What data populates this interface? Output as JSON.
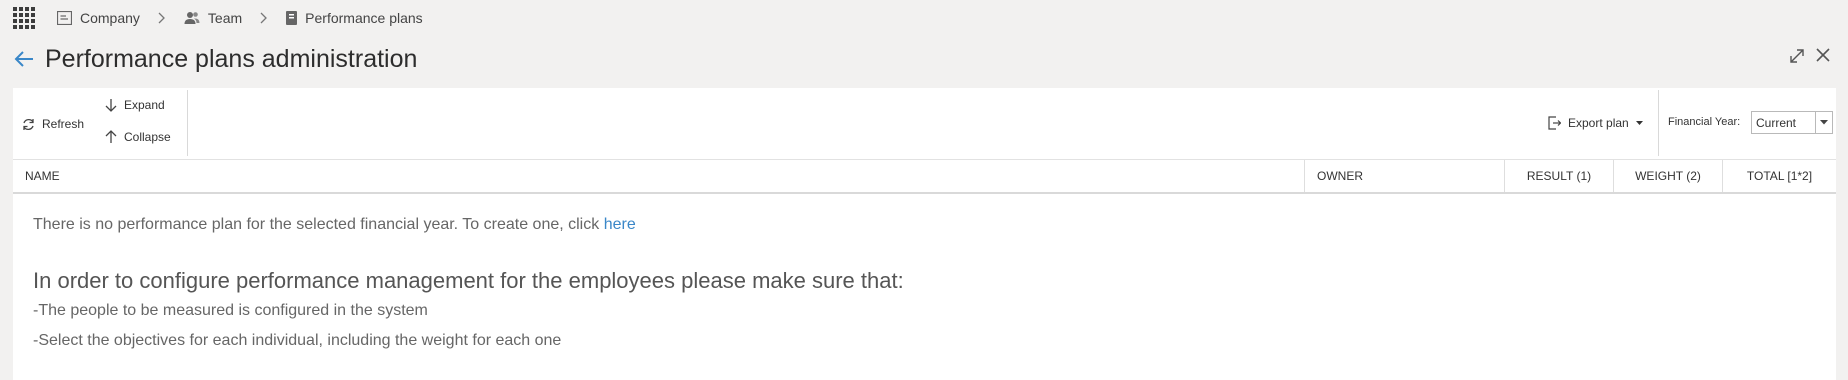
{
  "breadcrumb": {
    "items": [
      {
        "label": "Company",
        "icon": "company-icon"
      },
      {
        "label": "Team",
        "icon": "team-icon"
      },
      {
        "label": "Performance plans",
        "icon": "document-icon"
      }
    ]
  },
  "header": {
    "title": "Performance plans administration"
  },
  "toolbar": {
    "refresh_label": "Refresh",
    "expand_label": "Expand",
    "collapse_label": "Collapse",
    "export_label": "Export plan",
    "financial_year_label": "Financial Year:",
    "financial_year_value": "Current"
  },
  "table": {
    "columns": [
      "NAME",
      "OWNER",
      "RESULT (1)",
      "WEIGHT (2)",
      "TOTAL [1*2]"
    ]
  },
  "content": {
    "empty_message": "There is no performance plan for the selected financial year. To create one, click",
    "empty_link": "here",
    "config_heading": "In order to configure performance management for the employees please make sure that:",
    "config_items": [
      "-The people to be measured is configured in the system",
      "-Select the objectives for each individual, including the weight for each one"
    ]
  },
  "colors": {
    "accent": "#3a87c8",
    "background": "#f2f1f0",
    "panel": "#ffffff"
  }
}
